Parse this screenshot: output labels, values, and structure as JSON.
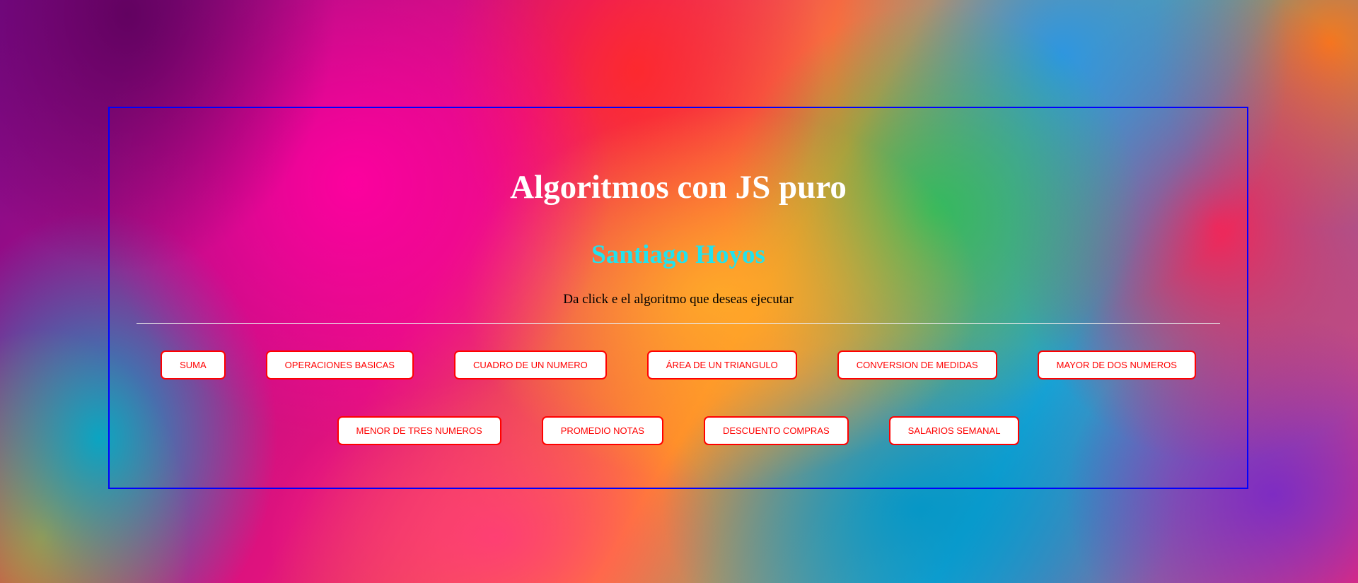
{
  "header": {
    "title": "Algoritmos con JS puro",
    "author": "Santiago Hoyos",
    "instruction": "Da click e el algoritmo que deseas ejecutar"
  },
  "buttons": {
    "row1": [
      "SUMA",
      "OPERACIONES BASICAS",
      "CUADRO DE UN NUMERO",
      "ÁREA DE UN TRIANGULO",
      "CONVERSION DE MEDIDAS",
      "MAYOR DE DOS NUMEROS"
    ],
    "row2": [
      "MENOR DE TRES NUMEROS",
      "PROMEDIO NOTAS",
      "DESCUENTO COMPRAS",
      "SALARIOS SEMANAL"
    ]
  },
  "colors": {
    "panel_border": "#0000ff",
    "title": "#ffffff",
    "author": "#22e2ee",
    "button_text": "#ff0000",
    "button_border": "#ff0000",
    "button_background": "#ffffff"
  }
}
